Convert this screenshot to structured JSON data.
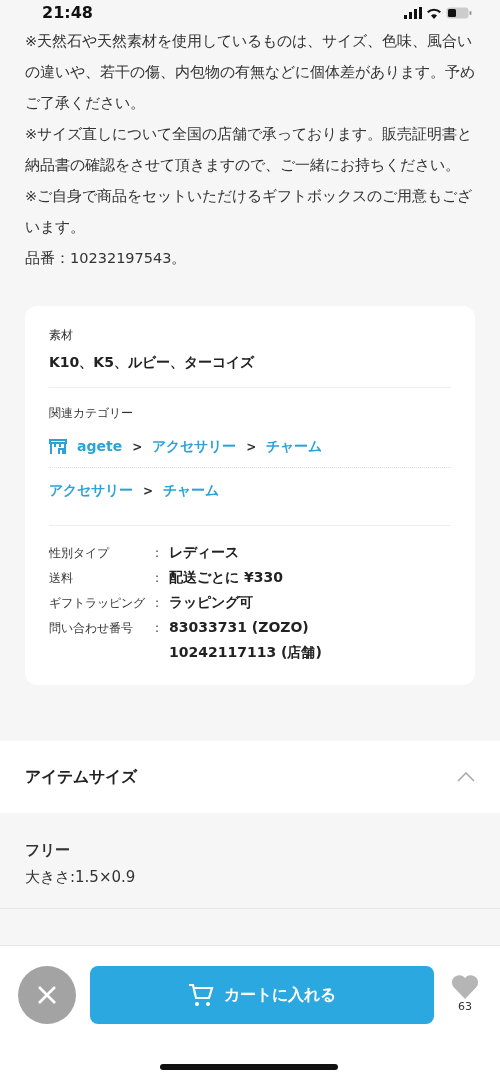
{
  "status_bar": {
    "time": "21:48"
  },
  "description": [
    "※天然石や天然素材を使用しているものは、サイズ、色味、風合いの違いや、若干の傷、内包物の有無などに個体差があります。予めご了承ください。",
    "※サイズ直しについて全国の店舗で承っております。販売証明書と納品書の確認をさせて頂きますので、ご一緒にお持ちください。",
    "※ご自身で商品をセットいただけるギフトボックスのご用意もございます。",
    "品番：10232197543。"
  ],
  "details": {
    "material": {
      "label": "素材",
      "value": "K10、K5、ルビー、ターコイズ"
    },
    "categories": {
      "label": "関連カテゴリー",
      "paths": [
        {
          "kind": "shop",
          "parts": [
            {
              "kind": "link",
              "text": "agete"
            },
            {
              "kind": "separator",
              "text": ">"
            },
            {
              "kind": "link",
              "text": "アクセサリー"
            },
            {
              "kind": "separator",
              "text": ">"
            },
            {
              "kind": "link",
              "text": "チャーム"
            }
          ]
        },
        {
          "kind": "plain",
          "parts": [
            {
              "kind": "link",
              "text": "アクセサリー"
            },
            {
              "kind": "separator",
              "text": ">"
            },
            {
              "kind": "link",
              "text": "チャーム"
            }
          ]
        }
      ]
    },
    "specs": [
      {
        "label": "性別タイプ",
        "colon": ":",
        "values": [
          "レディース"
        ]
      },
      {
        "label": "送料",
        "colon": ":",
        "values": [
          "配送ごとに ¥330"
        ]
      },
      {
        "label": "ギフトラッピング",
        "colon": ":",
        "values": [
          "ラッピング可"
        ]
      },
      {
        "label": "問い合わせ番号",
        "colon": ":",
        "values": [
          "83033731 (ZOZO)",
          "10242117113 (店舗)"
        ]
      }
    ]
  },
  "item_size": {
    "title": "アイテムサイズ",
    "expanded": true,
    "sizes": [
      {
        "name": "フリー",
        "detail": "大きさ:1.5×0.9"
      }
    ]
  },
  "bottom_bar": {
    "cart_button": "カートに入れる",
    "favorite_count": "63"
  }
}
